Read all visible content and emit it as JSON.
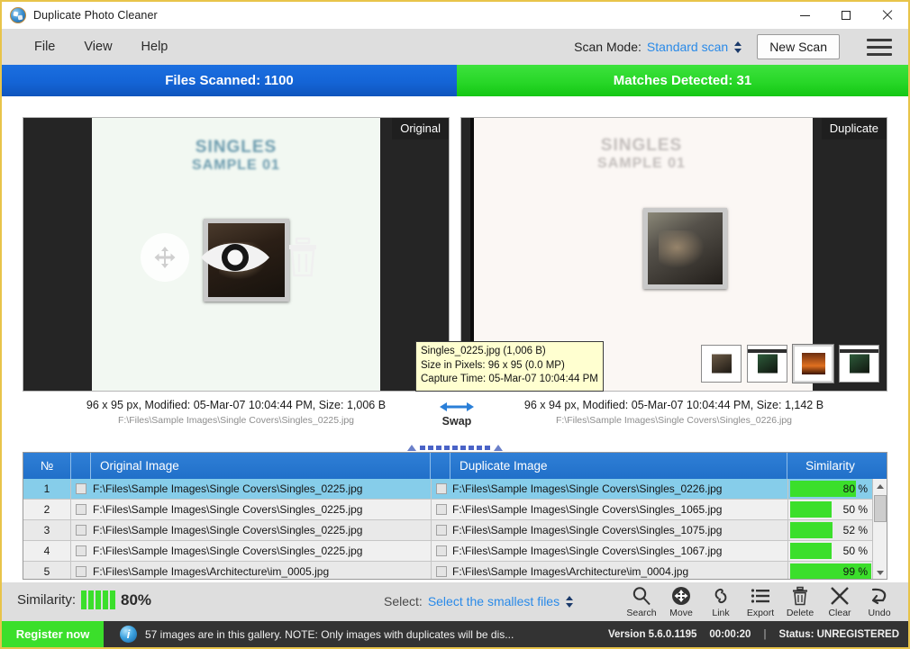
{
  "window": {
    "title": "Duplicate Photo Cleaner",
    "app_icon": "app-photos-icon",
    "minimize": "–",
    "maximize": "□",
    "close": "✕"
  },
  "menubar": {
    "items": [
      {
        "label": "File"
      },
      {
        "label": "View"
      },
      {
        "label": "Help"
      }
    ],
    "scan_mode_label": "Scan Mode:",
    "scan_mode_value": "Standard scan",
    "new_scan_label": "New Scan",
    "hamburger": "menu-icon"
  },
  "stats": {
    "files_scanned": "Files Scanned: 1100",
    "matches_detected": "Matches Detected: 31",
    "files_color": "#1464d6",
    "matches_color": "#28d728"
  },
  "preview": {
    "left": {
      "badge": "Original",
      "caption": "96 x 95 px, Modified: 05-Mar-07 10:04:44 PM, Size: 1,006 B",
      "path": "F:\\Files\\Sample Images\\Single Covers\\Singles_0225.jpg",
      "cover_line1": "SINGLES",
      "cover_line2": "SAMPLE 01",
      "overlay_icons": [
        "move-icon",
        "eye-icon",
        "trash-icon"
      ]
    },
    "right": {
      "badge": "Duplicate",
      "caption": "96 x 94 px, Modified: 05-Mar-07 10:04:44 PM, Size: 1,142 B",
      "path": "F:\\Files\\Sample Images\\Single Covers\\Singles_0226.jpg",
      "cover_line1": "SINGLES",
      "cover_line2": "SAMPLE 01"
    },
    "tooltip": {
      "line1": "Singles_0225.jpg (1,006 B)",
      "line2": "Size in Pixels: 96 x 95 (0.0 MP)",
      "line3": "Capture Time: 05-Mar-07 10:04:44 PM"
    },
    "swap_label": "Swap",
    "thumbnails": [
      {
        "name": "thumbnail-1",
        "selected": false
      },
      {
        "name": "thumbnail-2",
        "selected": false
      },
      {
        "name": "thumbnail-3",
        "selected": true
      },
      {
        "name": "thumbnail-4",
        "selected": false
      }
    ]
  },
  "table": {
    "columns": [
      "№",
      "",
      "Original Image",
      "",
      "Duplicate Image",
      "Similarity"
    ],
    "rows": [
      {
        "no": "1",
        "original": "F:\\Files\\Sample Images\\Single Covers\\Singles_0225.jpg",
        "duplicate": "F:\\Files\\Sample Images\\Single Covers\\Singles_0226.jpg",
        "similarity": "80 %",
        "similarity_value": 80,
        "selected": true,
        "orig_checked": false,
        "dup_checked": false
      },
      {
        "no": "2",
        "original": "F:\\Files\\Sample Images\\Single Covers\\Singles_0225.jpg",
        "duplicate": "F:\\Files\\Sample Images\\Single Covers\\Singles_1065.jpg",
        "similarity": "50 %",
        "similarity_value": 50,
        "selected": false,
        "orig_checked": false,
        "dup_checked": false
      },
      {
        "no": "3",
        "original": "F:\\Files\\Sample Images\\Single Covers\\Singles_0225.jpg",
        "duplicate": "F:\\Files\\Sample Images\\Single Covers\\Singles_1075.jpg",
        "similarity": "52 %",
        "similarity_value": 52,
        "selected": false,
        "orig_checked": false,
        "dup_checked": false
      },
      {
        "no": "4",
        "original": "F:\\Files\\Sample Images\\Single Covers\\Singles_0225.jpg",
        "duplicate": "F:\\Files\\Sample Images\\Single Covers\\Singles_1067.jpg",
        "similarity": "50 %",
        "similarity_value": 50,
        "selected": false,
        "orig_checked": false,
        "dup_checked": false
      },
      {
        "no": "5",
        "original": "F:\\Files\\Sample Images\\Architecture\\im_0005.jpg",
        "duplicate": "F:\\Files\\Sample Images\\Architecture\\im_0004.jpg",
        "similarity": "99 %",
        "similarity_value": 99,
        "selected": false,
        "orig_checked": false,
        "dup_checked": false
      }
    ]
  },
  "toolbar": {
    "similarity_label": "Similarity:",
    "similarity_value": "80%",
    "select_label": "Select:",
    "select_value": "Select the smallest files",
    "tools": [
      {
        "label": "Search",
        "icon": "search-icon"
      },
      {
        "label": "Move",
        "icon": "move-icon"
      },
      {
        "label": "Link",
        "icon": "link-icon"
      },
      {
        "label": "Export",
        "icon": "list-icon"
      },
      {
        "label": "Delete",
        "icon": "trash-icon"
      },
      {
        "label": "Clear",
        "icon": "close-icon"
      },
      {
        "label": "Undo",
        "icon": "undo-icon"
      }
    ]
  },
  "statusbar": {
    "register_label": "Register now",
    "info_icon": "info-icon",
    "message": "57 images are in this gallery. NOTE: Only images with duplicates will be dis...",
    "version": "Version 5.6.0.1195",
    "elapsed": "00:00:20",
    "separator": "|",
    "status": "Status: UNREGISTERED"
  }
}
